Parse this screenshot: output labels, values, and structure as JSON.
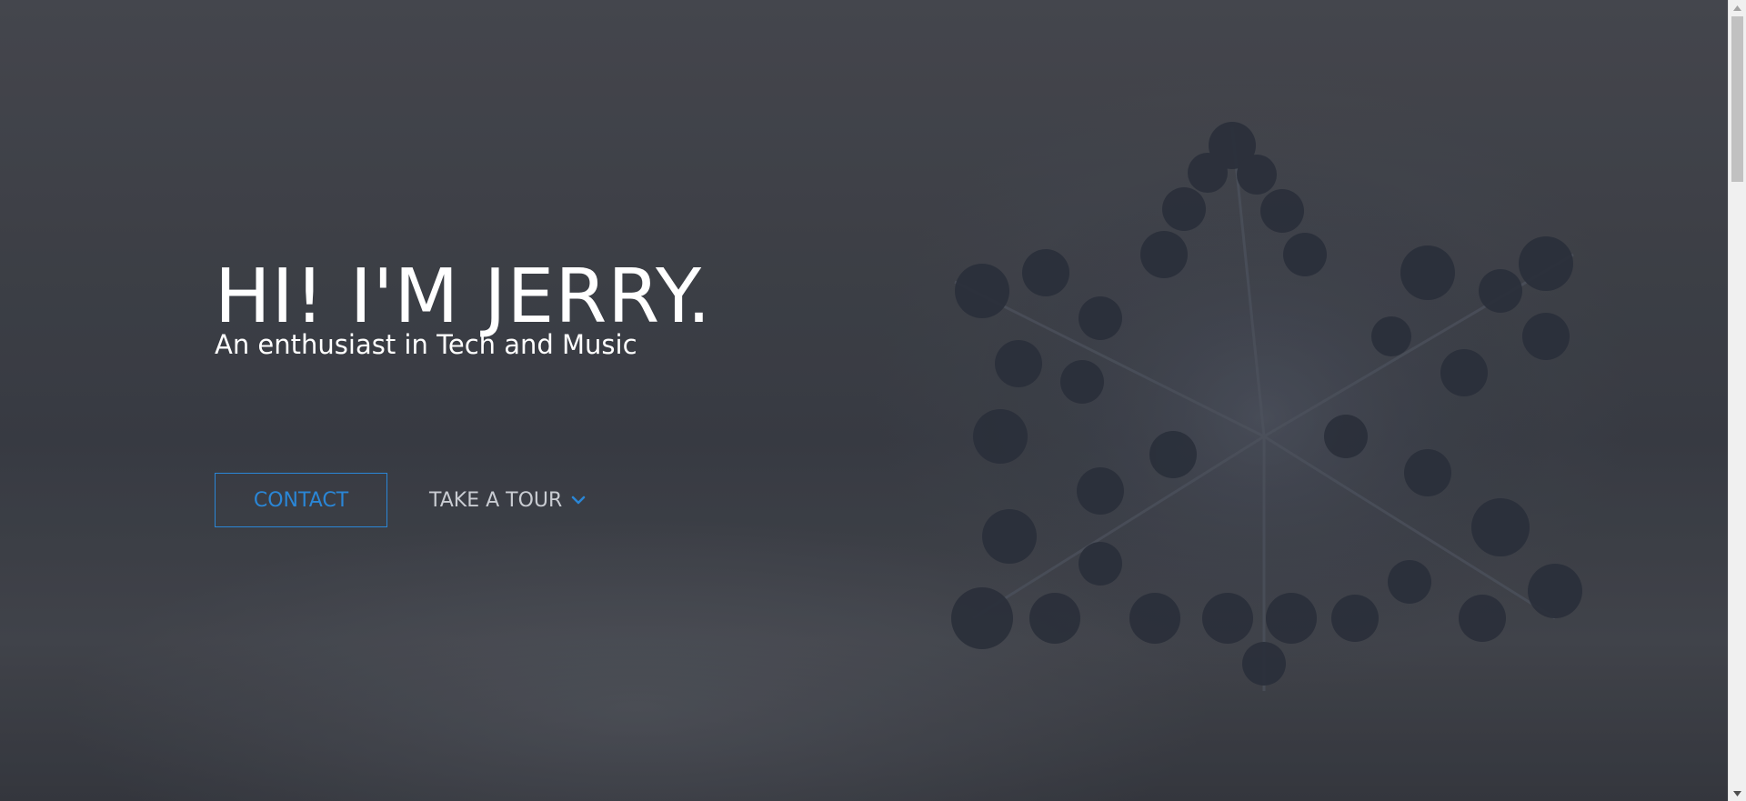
{
  "hero": {
    "title": "HI! I'M JERRY.",
    "subtitle": "An enthusiast in Tech and Music",
    "background_image": "snowflake-on-snow-icon"
  },
  "actions": {
    "contact_label": "CONTACT",
    "tour_label": "TAKE A TOUR",
    "tour_icon": "chevron-down-icon"
  },
  "colors": {
    "accent": "#2a86d6",
    "text_primary": "#ffffff",
    "text_muted": "#c9ccd2"
  }
}
